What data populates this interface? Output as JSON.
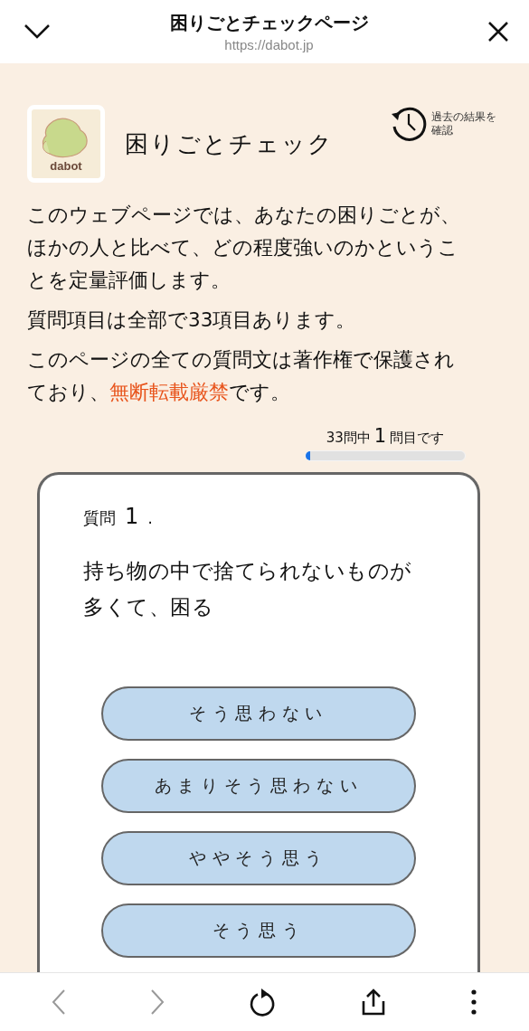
{
  "browser_bar": {
    "title": "困りごとチェックページ",
    "url": "https://dabot.jp"
  },
  "header": {
    "logo_text": "dabot",
    "title": "困りごとチェック",
    "history_link": "過去の結果を確認"
  },
  "intro": [
    [
      {
        "text": "このウェブページでは、あなたの困りごとが、ほかの人と比べて、どの程度強いのかということを定量評価します。",
        "emphasis": false
      }
    ],
    [
      {
        "text": "質問項目は全部で33項目あります。",
        "emphasis": false
      }
    ],
    [
      {
        "text": "このページの全ての質問文は著作権で保護されており、",
        "emphasis": false
      },
      {
        "text": "無断転載厳禁",
        "emphasis": true
      },
      {
        "text": "です。",
        "emphasis": false
      }
    ]
  ],
  "progress": {
    "total": "33問中",
    "current": "1",
    "suffix": "問目です",
    "level": 0.03
  },
  "question": {
    "label": "質問",
    "number": "1",
    "dot": ".",
    "text": "持ち物の中で捨てられないものが多くて、困る",
    "answers": [
      "そう思わない",
      "あまりそう思わない",
      "ややそう思う",
      "そう思う"
    ]
  },
  "toolbar": {
    "back_disabled": true,
    "forward_disabled": true
  }
}
